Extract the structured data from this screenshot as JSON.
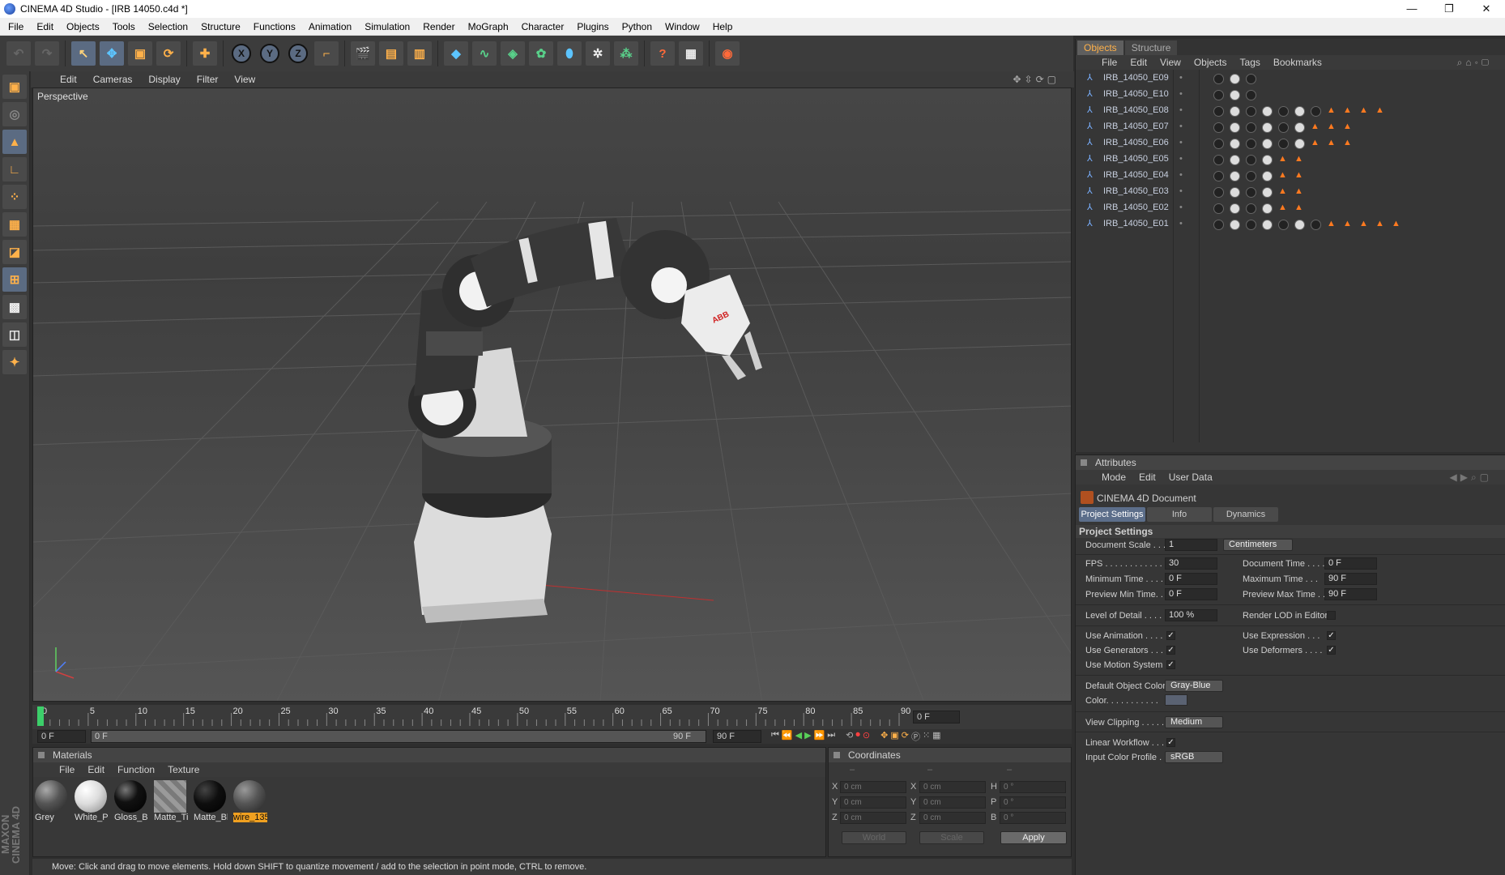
{
  "window": {
    "title": "CINEMA 4D Studio - [IRB 14050.c4d *]",
    "buttons": [
      "—",
      "❐",
      "✕"
    ]
  },
  "menu": [
    "File",
    "Edit",
    "Objects",
    "Tools",
    "Selection",
    "Structure",
    "Functions",
    "Animation",
    "Simulation",
    "Render",
    "MoGraph",
    "Character",
    "Plugins",
    "Python",
    "Window",
    "Help"
  ],
  "viewport": {
    "menu": [
      "Edit",
      "Cameras",
      "Display",
      "Filter",
      "View"
    ],
    "label": "Perspective",
    "brand_text": "ABB"
  },
  "timeline": {
    "ticks": [
      "0",
      "5",
      "10",
      "15",
      "20",
      "25",
      "30",
      "35",
      "40",
      "45",
      "50",
      "55",
      "60",
      "65",
      "70",
      "75",
      "80",
      "85",
      "90"
    ],
    "current_frame": "0 F",
    "start_field": "0 F",
    "range_start": "0 F",
    "range_end": "90 F",
    "end_field": "90 F"
  },
  "materials": {
    "title": "Materials",
    "menu": [
      "File",
      "Edit",
      "Function",
      "Texture"
    ],
    "items": [
      {
        "name": "Grey",
        "color": "#555555"
      },
      {
        "name": "White_P",
        "color": "#e8e8e8"
      },
      {
        "name": "Gloss_Bl",
        "color": "#111111"
      },
      {
        "name": "Matte_Ti",
        "color": "#8a8a8a"
      },
      {
        "name": "Matte_Bl",
        "color": "#0e0e0e"
      },
      {
        "name": "wire_135",
        "color": "#666666",
        "selected": true
      }
    ]
  },
  "coordinates": {
    "title": "Coordinates",
    "headers": [
      "–",
      "–",
      "–"
    ],
    "rows": [
      {
        "a": "X",
        "av": "0 cm",
        "b": "X",
        "bv": "0 cm",
        "c": "H",
        "cv": "0 °"
      },
      {
        "a": "Y",
        "av": "0 cm",
        "b": "Y",
        "bv": "0 cm",
        "c": "P",
        "cv": "0 °"
      },
      {
        "a": "Z",
        "av": "0 cm",
        "b": "Z",
        "bv": "0 cm",
        "c": "B",
        "cv": "0 °"
      }
    ],
    "space": "World",
    "mode": "Scale",
    "apply": "Apply"
  },
  "status": "Move: Click and drag to move elements. Hold down SHIFT to quantize movement / add to the selection in point mode, CTRL to remove.",
  "objects_panel": {
    "tabs": [
      "Objects",
      "Structure"
    ],
    "menu": [
      "File",
      "Edit",
      "View",
      "Objects",
      "Tags",
      "Bookmarks"
    ],
    "rows": [
      {
        "name": "IRB_14050_E09",
        "tags": 3,
        "tris": 0
      },
      {
        "name": "IRB_14050_E10",
        "tags": 3,
        "tris": 0
      },
      {
        "name": "IRB_14050_E08",
        "tags": 7,
        "tris": 4
      },
      {
        "name": "IRB_14050_E07",
        "tags": 6,
        "tris": 3
      },
      {
        "name": "IRB_14050_E06",
        "tags": 6,
        "tris": 3
      },
      {
        "name": "IRB_14050_E05",
        "tags": 4,
        "tris": 2
      },
      {
        "name": "IRB_14050_E04",
        "tags": 4,
        "tris": 2
      },
      {
        "name": "IRB_14050_E03",
        "tags": 4,
        "tris": 2
      },
      {
        "name": "IRB_14050_E02",
        "tags": 4,
        "tris": 2
      },
      {
        "name": "IRB_14050_E01",
        "tags": 7,
        "tris": 5
      }
    ]
  },
  "attributes": {
    "title": "Attributes",
    "menu": [
      "Mode",
      "Edit",
      "User Data"
    ],
    "object": "CINEMA 4D Document",
    "tabs": [
      "Project Settings",
      "Info",
      "Dynamics"
    ],
    "section": "Project Settings",
    "document_scale_label": "Document Scale . . .",
    "document_scale": "1",
    "document_unit": "Centimeters",
    "fps_label": "FPS . . . . . . . . . . . .",
    "fps": "30",
    "doc_time_label": "Document Time . . . .",
    "doc_time": "0 F",
    "min_time_label": "Minimum Time . . . .",
    "min_time": "0 F",
    "max_time_label": "Maximum Time . . .",
    "max_time": "90 F",
    "prev_min_label": "Preview Min Time. .",
    "prev_min": "0 F",
    "prev_max_label": "Preview Max Time . .",
    "prev_max": "90 F",
    "lod_label": "Level of Detail . . . .",
    "lod": "100 %",
    "render_lod_label": "Render LOD in Editor",
    "use_anim_label": "Use Animation . . . .",
    "use_expr_label": "Use Expression . . .",
    "use_gen_label": "Use Generators . . .",
    "use_def_label": "Use Deformers . . . .",
    "use_motion_label": "Use Motion System",
    "check_mark": "✓",
    "def_color_label": "Default Object Color",
    "def_color": "Gray-Blue",
    "color_label": "Color. . . . . . . . . . .",
    "view_clip_label": "View Clipping . . . . .",
    "view_clip": "Medium",
    "linear_label": "Linear Workflow . . .",
    "input_profile_label": "Input Color Profile . .",
    "input_profile": "sRGB"
  }
}
